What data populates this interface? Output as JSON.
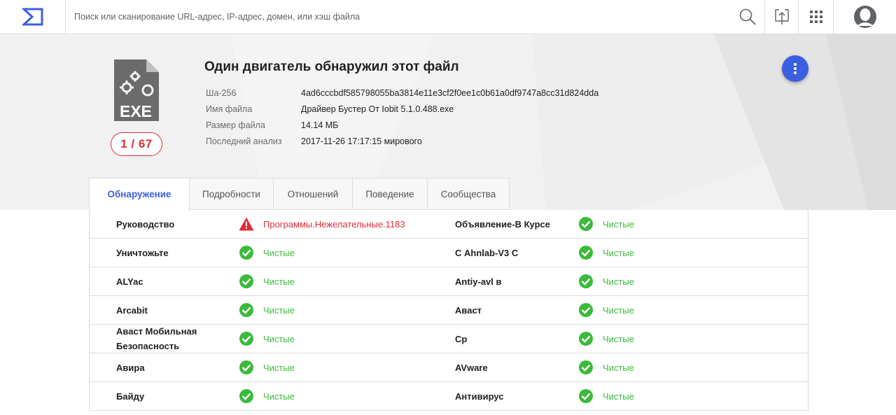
{
  "search": {
    "placeholder": "Поиск или сканирование URL-адрес, IP-адрес, домен, или хэш файла"
  },
  "icons": {
    "logo": "sigma-logo-icon",
    "search": "search-icon",
    "upload": "upload-icon",
    "apps": "apps-grid-icon",
    "account": "account-icon",
    "more": "more-vert-icon",
    "file_type": "exe-file-icon",
    "alert": "alert-triangle-icon",
    "clean": "check-circle-icon"
  },
  "colors": {
    "accent": "#3b5fe2",
    "detected": "#e02c37",
    "clean": "#3bba3b"
  },
  "summary": {
    "ratio": "1 / 67",
    "title": "Один двигатель обнаружил этот файл",
    "file_icon_label": "EXE",
    "details": [
      {
        "label": "Ша-256",
        "value": "4ad6cccbdf585798055ba3814e11e3cf2f0ee1c0b61a0df9747a8cc31d824dda"
      },
      {
        "label": "Имя файла",
        "value": "Драйвер Бустер От Iobit 5.1.0.488.exe"
      },
      {
        "label": "Размер файла",
        "value": "14.14 МБ"
      },
      {
        "label": "Последний анализ",
        "value": "2017-11-26 17:17:15 мирового"
      }
    ]
  },
  "tabs": [
    {
      "label": "Обнаружение",
      "active": true
    },
    {
      "label": "Подробности",
      "active": false
    },
    {
      "label": "Отношений",
      "active": false
    },
    {
      "label": "Поведение",
      "active": false
    },
    {
      "label": "Сообщества",
      "active": false
    }
  ],
  "results": [
    {
      "left": {
        "engine": "Руководство",
        "result": "Программы.Нежелательные.1183",
        "status": "detected"
      },
      "right": {
        "engine": "Объявление-В Курсе",
        "result": "Чистые",
        "status": "clean"
      }
    },
    {
      "left": {
        "engine": "Уничтожьте",
        "result": "Чистые",
        "status": "clean"
      },
      "right": {
        "engine": "С Ahnlab-V3 С",
        "result": "Чистые",
        "status": "clean"
      }
    },
    {
      "left": {
        "engine": "ALYac",
        "result": "Чистые",
        "status": "clean"
      },
      "right": {
        "engine": "Antiy-avl в",
        "result": "Чистые",
        "status": "clean"
      }
    },
    {
      "left": {
        "engine": "Arcabit",
        "result": "Чистые",
        "status": "clean"
      },
      "right": {
        "engine": "Аваст",
        "result": "Чистые",
        "status": "clean"
      }
    },
    {
      "left": {
        "engine": "Аваст Мобильная Безопасность",
        "result": "Чистые",
        "status": "clean"
      },
      "right": {
        "engine": "Ср",
        "result": "Чистые",
        "status": "clean"
      }
    },
    {
      "left": {
        "engine": "Авира",
        "result": "Чистые",
        "status": "clean"
      },
      "right": {
        "engine": "AVware",
        "result": "Чистые",
        "status": "clean"
      }
    },
    {
      "left": {
        "engine": "Байду",
        "result": "Чистые",
        "status": "clean"
      },
      "right": {
        "engine": "Антивирус",
        "result": "Чистые",
        "status": "clean"
      }
    }
  ]
}
